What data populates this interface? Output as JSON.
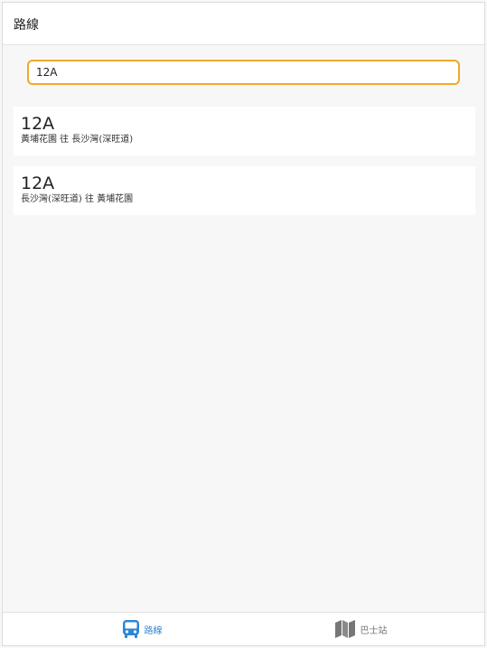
{
  "header": {
    "title": "路線"
  },
  "search": {
    "value": "12A",
    "placeholder": ""
  },
  "routes": [
    {
      "number": "12A",
      "direction": "黃埔花園 往 長沙灣(深旺道)"
    },
    {
      "number": "12A",
      "direction": "長沙灣(深旺道) 往 黃埔花園"
    }
  ],
  "bottom_nav": {
    "items": [
      {
        "label": "路線",
        "icon": "bus-icon",
        "active": true,
        "color": "#2e86d6"
      },
      {
        "label": "巴士站",
        "icon": "map-icon",
        "active": false,
        "color": "#777777"
      }
    ]
  },
  "colors": {
    "accent": "#f0a92c",
    "active_tab": "#2e86d6",
    "background": "#f7f7f7"
  }
}
